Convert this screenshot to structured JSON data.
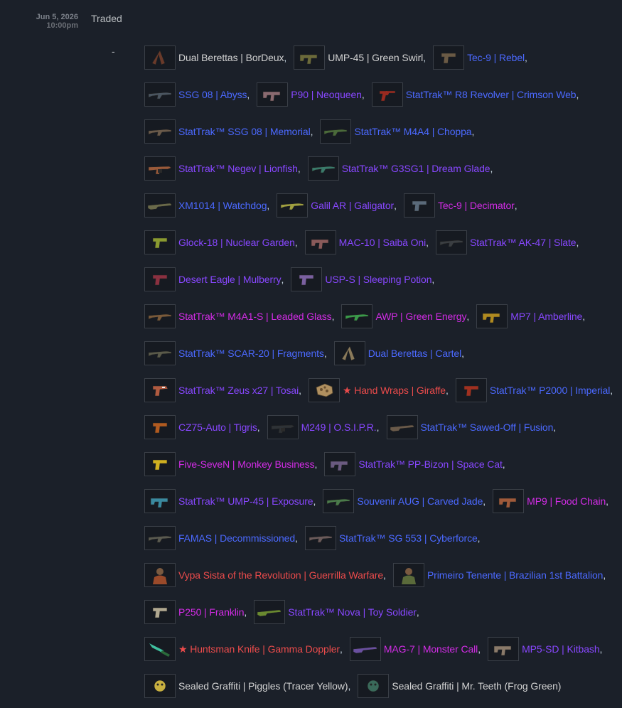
{
  "entry": {
    "date": "Jun 5, 2026",
    "time": "10:00pm",
    "description": "Traded",
    "dash": "-"
  },
  "rarity_colors": {
    "base": "#d2d2d2",
    "milspec": "#4b69ff",
    "restricted": "#8847ff",
    "classified": "#d32ce6",
    "covert": "#eb4b4b"
  },
  "rows": [
    [
      {
        "name": "Dual Berettas | BorDeux",
        "color": "#d2d2d2",
        "icon": "dual-berettas-icon",
        "tint": "#6a3a2a"
      },
      {
        "name": "UMP-45 | Green Swirl",
        "color": "#d2d2d2",
        "icon": "smg-icon",
        "tint": "#6b6a3a"
      },
      {
        "name": "Tec-9 | Rebel",
        "color": "#4b69ff",
        "icon": "pistol-icon",
        "tint": "#6a5a45"
      }
    ],
    [
      {
        "name": "SSG 08 | Abyss",
        "color": "#4b69ff",
        "icon": "rifle-icon",
        "tint": "#4a5560"
      },
      {
        "name": "P90 | Neoqueen",
        "color": "#8847ff",
        "icon": "smg-icon",
        "tint": "#8a6a70"
      },
      {
        "name": "StatTrak™ R8 Revolver | Crimson Web",
        "color": "#4b69ff",
        "icon": "revolver-icon",
        "tint": "#9a2a20"
      }
    ],
    [
      {
        "name": "StatTrak™ SSG 08 | Memorial",
        "color": "#4b69ff",
        "icon": "rifle-icon",
        "tint": "#6a5a4a"
      },
      {
        "name": "StatTrak™ M4A4 | Choppa",
        "color": "#4b69ff",
        "icon": "rifle-icon",
        "tint": "#4a6a3a"
      }
    ],
    [
      {
        "name": "StatTrak™ Negev | Lionfish",
        "color": "#8847ff",
        "icon": "machinegun-icon",
        "tint": "#9a5a3a"
      },
      {
        "name": "StatTrak™ G3SG1 | Dream Glade",
        "color": "#8847ff",
        "icon": "rifle-icon",
        "tint": "#3a7a6a"
      }
    ],
    [
      {
        "name": "XM1014 | Watchdog",
        "color": "#4b69ff",
        "icon": "shotgun-icon",
        "tint": "#6a6a4a"
      },
      {
        "name": "Galil AR | Galigator",
        "color": "#8847ff",
        "icon": "rifle-icon",
        "tint": "#a0a040"
      },
      {
        "name": "Tec-9 | Decimator",
        "color": "#d32ce6",
        "icon": "pistol-icon",
        "tint": "#5a6a7a"
      }
    ],
    [
      {
        "name": "Glock-18 | Nuclear Garden",
        "color": "#8847ff",
        "icon": "pistol-icon",
        "tint": "#8a9a30"
      },
      {
        "name": "MAC-10 | Saibā Oni",
        "color": "#8847ff",
        "icon": "smg-icon",
        "tint": "#8a5a5a"
      },
      {
        "name": "StatTrak™ AK-47 | Slate",
        "color": "#8847ff",
        "icon": "rifle-icon",
        "tint": "#3a3e42"
      }
    ],
    [
      {
        "name": "Desert Eagle | Mulberry",
        "color": "#8847ff",
        "icon": "pistol-icon",
        "tint": "#8a3040"
      },
      {
        "name": "USP-S | Sleeping Potion",
        "color": "#8847ff",
        "icon": "pistol-icon",
        "tint": "#7a60a0"
      }
    ],
    [
      {
        "name": "StatTrak™ M4A1-S | Leaded Glass",
        "color": "#d32ce6",
        "icon": "rifle-icon",
        "tint": "#7a5a3a"
      },
      {
        "name": "AWP | Green Energy",
        "color": "#d32ce6",
        "icon": "rifle-icon",
        "tint": "#3a9a4a"
      },
      {
        "name": "MP7 | Amberline",
        "color": "#8847ff",
        "icon": "smg-icon",
        "tint": "#b08a20"
      }
    ],
    [
      {
        "name": "StatTrak™ SCAR-20 | Fragments",
        "color": "#4b69ff",
        "icon": "rifle-icon",
        "tint": "#5a5a4a"
      },
      {
        "name": "Dual Berettas | Cartel",
        "color": "#4b69ff",
        "icon": "dual-berettas-icon",
        "tint": "#8a7a5a"
      }
    ],
    [
      {
        "name": "StatTrak™ Zeus x27 | Tosai",
        "color": "#8847ff",
        "icon": "taser-icon",
        "tint": "#b05a40"
      },
      {
        "name": "★ Hand Wraps | Giraffe",
        "color": "#eb4b4b",
        "icon": "gloves-icon",
        "tint": "#b09060"
      },
      {
        "name": "StatTrak™ P2000 | Imperial",
        "color": "#4b69ff",
        "icon": "pistol-icon",
        "tint": "#a03020"
      }
    ],
    [
      {
        "name": "CZ75-Auto | Tigris",
        "color": "#8847ff",
        "icon": "pistol-icon",
        "tint": "#b05a20"
      },
      {
        "name": "M249 | O.S.I.P.R.",
        "color": "#8847ff",
        "icon": "machinegun-icon",
        "tint": "#2e3236"
      },
      {
        "name": "StatTrak™ Sawed-Off | Fusion",
        "color": "#4b69ff",
        "icon": "shotgun-icon",
        "tint": "#6a5a4a"
      }
    ],
    [
      {
        "name": "Five-SeveN | Monkey Business",
        "color": "#d32ce6",
        "icon": "pistol-icon",
        "tint": "#d0b020"
      },
      {
        "name": "StatTrak™ PP-Bizon | Space Cat",
        "color": "#8847ff",
        "icon": "smg-icon",
        "tint": "#6a5a80"
      }
    ],
    [
      {
        "name": "StatTrak™ UMP-45 | Exposure",
        "color": "#8847ff",
        "icon": "smg-icon",
        "tint": "#3a8aa0"
      },
      {
        "name": "Souvenir AUG | Carved Jade",
        "color": "#4b69ff",
        "icon": "rifle-icon",
        "tint": "#4a7a4a"
      },
      {
        "name": "MP9 | Food Chain",
        "color": "#d32ce6",
        "icon": "smg-icon",
        "tint": "#a05a3a"
      }
    ],
    [
      {
        "name": "FAMAS | Decommissioned",
        "color": "#4b69ff",
        "icon": "rifle-icon",
        "tint": "#5a5a50"
      },
      {
        "name": "StatTrak™ SG 553 | Cyberforce",
        "color": "#4b69ff",
        "icon": "rifle-icon",
        "tint": "#6a5a5a"
      }
    ],
    [
      {
        "name": "Vypa Sista of the Revolution | Guerrilla Warfare",
        "color": "#eb4b4b",
        "icon": "agent-icon",
        "tint": "#9a4a2a"
      },
      {
        "name": "Primeiro Tenente | Brazilian 1st Battalion",
        "color": "#4b69ff",
        "icon": "agent-icon",
        "tint": "#5a6a3a"
      }
    ],
    [
      {
        "name": "P250 | Franklin",
        "color": "#d32ce6",
        "icon": "pistol-icon",
        "tint": "#b0a890"
      },
      {
        "name": "StatTrak™ Nova | Toy Soldier",
        "color": "#8847ff",
        "icon": "shotgun-icon",
        "tint": "#6a8a30"
      }
    ],
    [
      {
        "name": "★ Huntsman Knife | Gamma Doppler",
        "color": "#eb4b4b",
        "icon": "knife-icon",
        "tint": "#40c0a0"
      },
      {
        "name": "MAG-7 | Monster Call",
        "color": "#d32ce6",
        "icon": "shotgun-icon",
        "tint": "#6a50a0"
      },
      {
        "name": "MP5-SD | Kitbash",
        "color": "#8847ff",
        "icon": "smg-icon",
        "tint": "#8a7a6a"
      }
    ],
    [
      {
        "name": "Sealed Graffiti | Piggles (Tracer Yellow)",
        "color": "#d2d2d2",
        "icon": "graffiti-icon",
        "tint": "#c8b040"
      },
      {
        "name": "Sealed Graffiti | Mr. Teeth (Frog Green)",
        "color": "#d2d2d2",
        "icon": "graffiti-icon",
        "tint": "#3a6a5a"
      }
    ]
  ]
}
